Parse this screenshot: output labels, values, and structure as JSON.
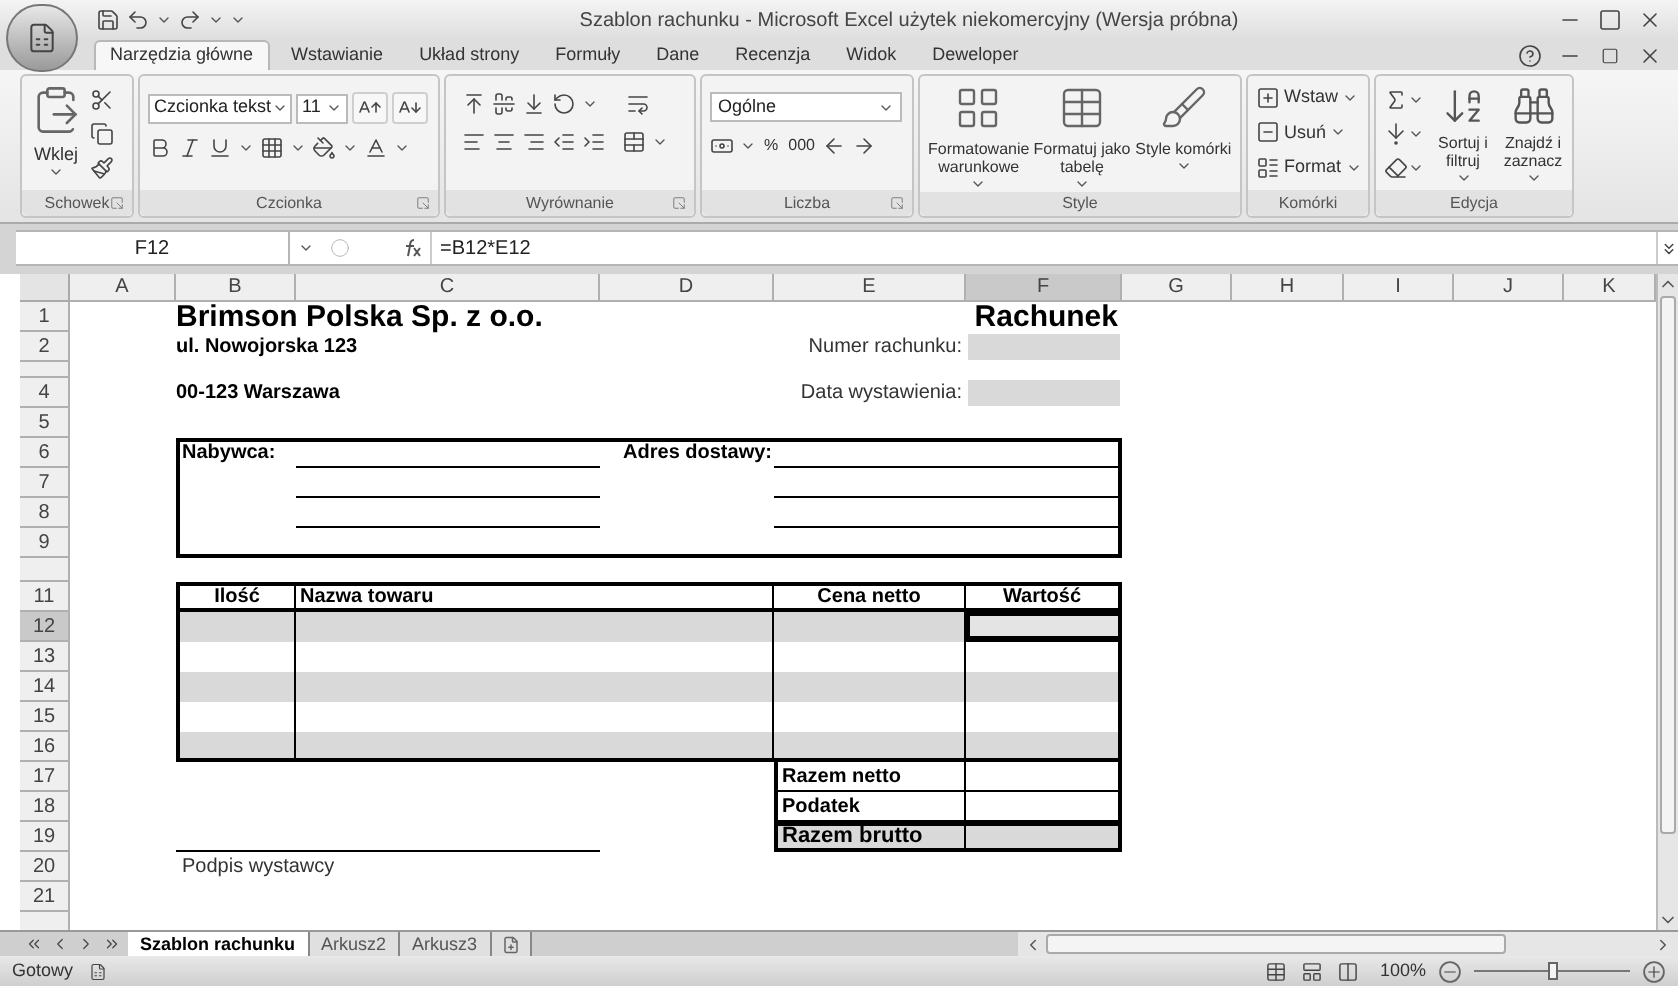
{
  "window": {
    "title": "Szablon rachunku - Microsoft Excel użytek niekomercyjny (Wersja próbna)"
  },
  "tabs": [
    {
      "label": "Narzędzia główne",
      "selected": true
    },
    {
      "label": "Wstawianie",
      "selected": false
    },
    {
      "label": "Układ strony",
      "selected": false
    },
    {
      "label": "Formuły",
      "selected": false
    },
    {
      "label": "Dane",
      "selected": false
    },
    {
      "label": "Recenzja",
      "selected": false
    },
    {
      "label": "Widok",
      "selected": false
    },
    {
      "label": "Deweloper",
      "selected": false
    }
  ],
  "ribbon": {
    "groups": [
      {
        "kind": "clipboard",
        "label": "Schowek",
        "paste_label": "Wklej"
      },
      {
        "kind": "font",
        "label": "Czcionka",
        "font_name": "Czcionka tekst",
        "font_size": "11"
      },
      {
        "kind": "alignment",
        "label": "Wyrównanie"
      },
      {
        "kind": "number",
        "label": "Liczba",
        "format": "Ogólne",
        "buttons": [
          "%",
          "000"
        ]
      },
      {
        "kind": "styles",
        "label": "Style",
        "buttons": [
          "Formatowanie warunkowe",
          "Formatuj jako tabelę",
          "Style komórki"
        ]
      },
      {
        "kind": "cells",
        "label": "Komórki",
        "buttons": [
          "Wstaw",
          "Usuń",
          "Format"
        ]
      },
      {
        "kind": "editing",
        "label": "Edycja",
        "buttons": [
          "Sortuj i filtruj",
          "Znajdź i zaznacz"
        ]
      }
    ]
  },
  "formula_bar": {
    "cell_ref": "F12",
    "formula": "=B12*E12"
  },
  "sheet": {
    "columns": [
      {
        "label": "A",
        "selected": false
      },
      {
        "label": "B",
        "selected": false
      },
      {
        "label": "C",
        "selected": false
      },
      {
        "label": "D",
        "selected": false
      },
      {
        "label": "E",
        "selected": false
      },
      {
        "label": "F",
        "selected": true
      },
      {
        "label": "G",
        "selected": false
      },
      {
        "label": "H",
        "selected": false
      },
      {
        "label": "I",
        "selected": false
      },
      {
        "label": "J",
        "selected": false
      },
      {
        "label": "K",
        "selected": false
      }
    ],
    "rows": [
      {
        "kind": "row",
        "label": "1",
        "selected": false
      },
      {
        "kind": "row",
        "label": "2",
        "selected": false
      },
      {
        "kind": "thin"
      },
      {
        "kind": "row",
        "label": "4",
        "selected": false
      },
      {
        "kind": "row",
        "label": "5",
        "selected": false
      },
      {
        "kind": "row",
        "label": "6",
        "selected": false
      },
      {
        "kind": "row",
        "label": "7",
        "selected": false
      },
      {
        "kind": "row",
        "label": "8",
        "selected": false
      },
      {
        "kind": "row",
        "label": "9",
        "selected": false
      },
      {
        "kind": "thin"
      },
      {
        "kind": "row",
        "label": "11",
        "selected": false
      },
      {
        "kind": "row",
        "label": "12",
        "selected": true
      },
      {
        "kind": "row",
        "label": "13",
        "selected": false
      },
      {
        "kind": "row",
        "label": "14",
        "selected": false
      },
      {
        "kind": "row",
        "label": "15",
        "selected": false
      },
      {
        "kind": "row",
        "label": "16",
        "selected": false
      },
      {
        "kind": "row",
        "label": "17",
        "selected": false
      },
      {
        "kind": "row",
        "label": "18",
        "selected": false
      },
      {
        "kind": "row",
        "label": "19",
        "selected": false
      },
      {
        "kind": "row",
        "label": "20",
        "selected": false
      },
      {
        "kind": "row",
        "label": "21",
        "selected": false
      },
      {
        "kind": "thin"
      }
    ]
  },
  "invoice": {
    "company": "Brimson Polska Sp. z o.o.",
    "street": "ul. Nowojorska 123",
    "city": "00-123 Warszawa",
    "title": "Rachunek",
    "fields": [
      {
        "label": "Numer rachunku:"
      },
      {
        "label": "Data wystawienia:"
      }
    ],
    "buyer_label": "Nabywca:",
    "delivery_label": "Adres dostawy:",
    "items": {
      "columns": [
        "Ilość",
        "Nazwa towaru",
        "Cena netto",
        "Wartość"
      ],
      "rows": [
        {
          "shaded": true,
          "selected": true
        },
        {
          "shaded": false,
          "selected": false
        },
        {
          "shaded": true,
          "selected": false
        },
        {
          "shaded": false,
          "selected": false
        },
        {
          "shaded": true,
          "selected": false
        }
      ]
    },
    "totals": [
      {
        "label": "Razem netto",
        "shaded": false
      },
      {
        "label": "Podatek",
        "shaded": false
      },
      {
        "label": "Razem brutto",
        "shaded": true
      }
    ],
    "signature_label": "Podpis wystawcy"
  },
  "sheet_tabs": [
    {
      "label": "Szablon rachunku",
      "selected": true
    },
    {
      "label": "Arkusz2",
      "selected": false
    },
    {
      "label": "Arkusz3",
      "selected": false
    }
  ],
  "status_bar": {
    "status": "Gotowy",
    "zoom": "100%",
    "zoom_slider": {
      "level": 0.5
    }
  }
}
